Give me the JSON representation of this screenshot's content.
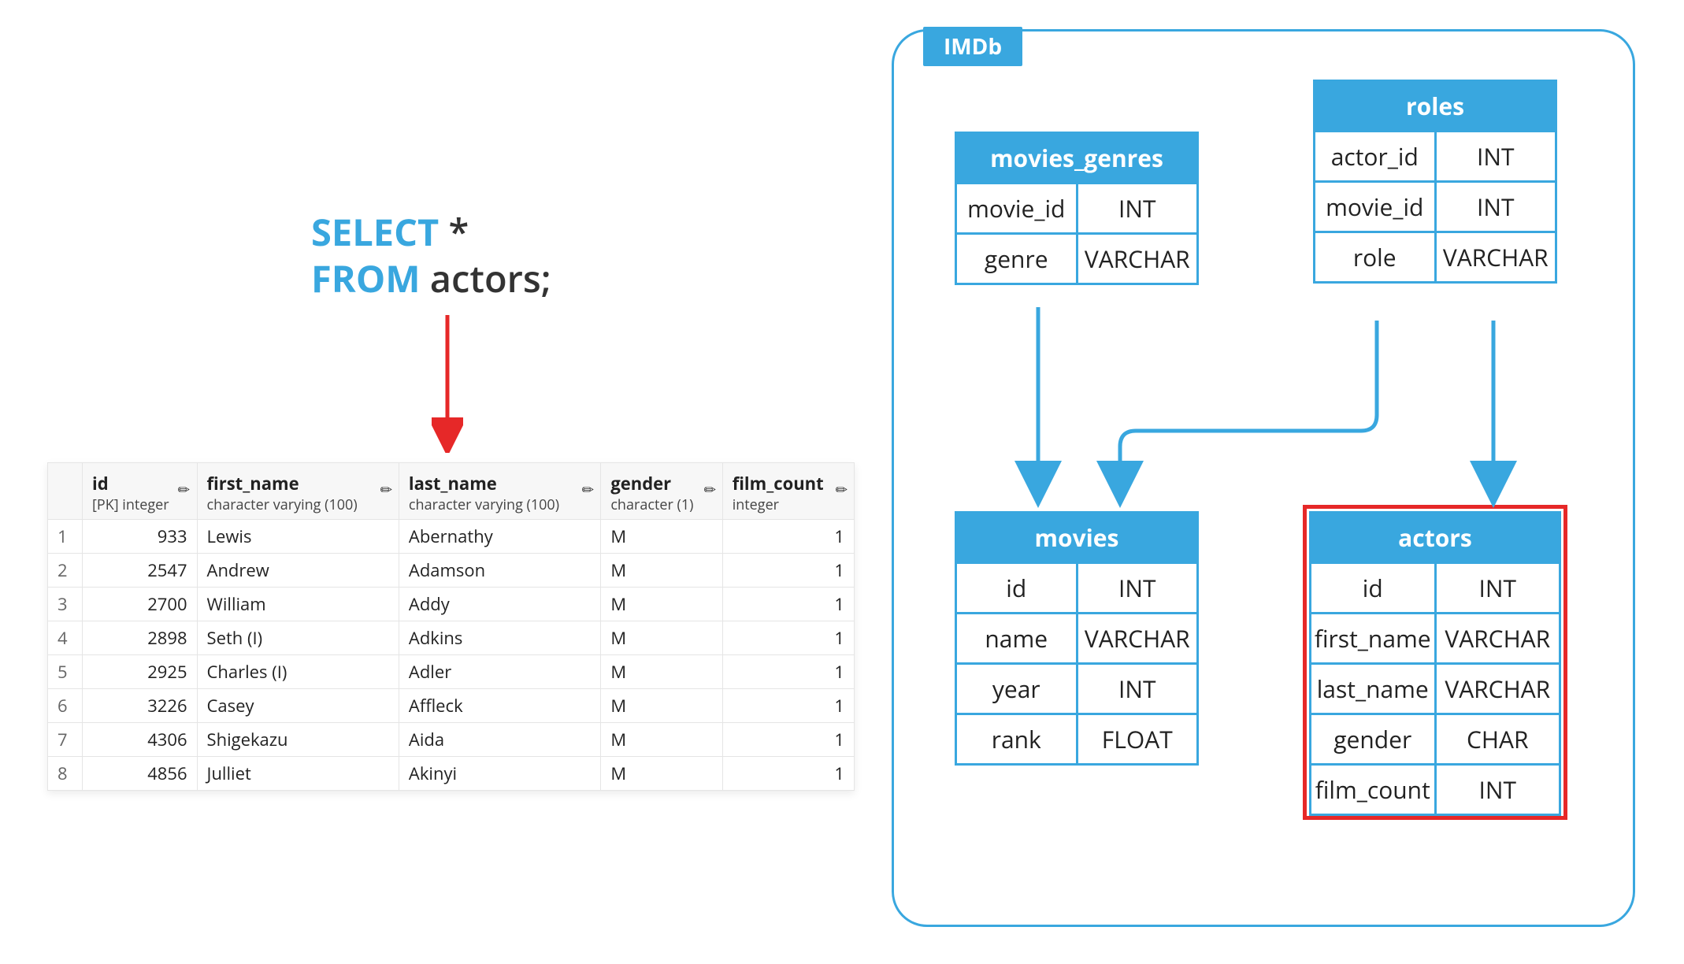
{
  "sql": {
    "kw_select": "SELECT",
    "star": "*",
    "kw_from": "FROM",
    "table": "actors;"
  },
  "result": {
    "columns": [
      {
        "name": "id",
        "type": "[PK] integer",
        "align": "right"
      },
      {
        "name": "first_name",
        "type": "character varying (100)",
        "align": "left"
      },
      {
        "name": "last_name",
        "type": "character varying (100)",
        "align": "left"
      },
      {
        "name": "gender",
        "type": "character (1)",
        "align": "left"
      },
      {
        "name": "film_count",
        "type": "integer",
        "align": "right"
      }
    ],
    "rows": [
      {
        "n": "1",
        "id": "933",
        "first_name": "Lewis",
        "last_name": "Abernathy",
        "gender": "M",
        "film_count": "1"
      },
      {
        "n": "2",
        "id": "2547",
        "first_name": "Andrew",
        "last_name": "Adamson",
        "gender": "M",
        "film_count": "1"
      },
      {
        "n": "3",
        "id": "2700",
        "first_name": "William",
        "last_name": "Addy",
        "gender": "M",
        "film_count": "1"
      },
      {
        "n": "4",
        "id": "2898",
        "first_name": "Seth (I)",
        "last_name": "Adkins",
        "gender": "M",
        "film_count": "1"
      },
      {
        "n": "5",
        "id": "2925",
        "first_name": "Charles (I)",
        "last_name": "Adler",
        "gender": "M",
        "film_count": "1"
      },
      {
        "n": "6",
        "id": "3226",
        "first_name": "Casey",
        "last_name": "Affleck",
        "gender": "M",
        "film_count": "1"
      },
      {
        "n": "7",
        "id": "4306",
        "first_name": "Shigekazu",
        "last_name": "Aida",
        "gender": "M",
        "film_count": "1"
      },
      {
        "n": "8",
        "id": "4856",
        "first_name": "Julliet",
        "last_name": "Akinyi",
        "gender": "M",
        "film_count": "1"
      }
    ]
  },
  "schema": {
    "label": "IMDb",
    "tables": {
      "movies_genres": {
        "title": "movies_genres",
        "rows": [
          [
            "movie_id",
            "INT"
          ],
          [
            "genre",
            "VARCHAR"
          ]
        ]
      },
      "roles": {
        "title": "roles",
        "rows": [
          [
            "actor_id",
            "INT"
          ],
          [
            "movie_id",
            "INT"
          ],
          [
            "role",
            "VARCHAR"
          ]
        ]
      },
      "movies": {
        "title": "movies",
        "rows": [
          [
            "id",
            "INT"
          ],
          [
            "name",
            "VARCHAR"
          ],
          [
            "year",
            "INT"
          ],
          [
            "rank",
            "FLOAT"
          ]
        ]
      },
      "actors": {
        "title": "actors",
        "rows": [
          [
            "id",
            "INT"
          ],
          [
            "first_name",
            "VARCHAR"
          ],
          [
            "last_name",
            "VARCHAR"
          ],
          [
            "gender",
            "CHAR"
          ],
          [
            "film_count",
            "INT"
          ]
        ]
      }
    }
  },
  "icons": {
    "pencil": "✎"
  },
  "colors": {
    "blue": "#39a7df",
    "red": "#e62828"
  }
}
